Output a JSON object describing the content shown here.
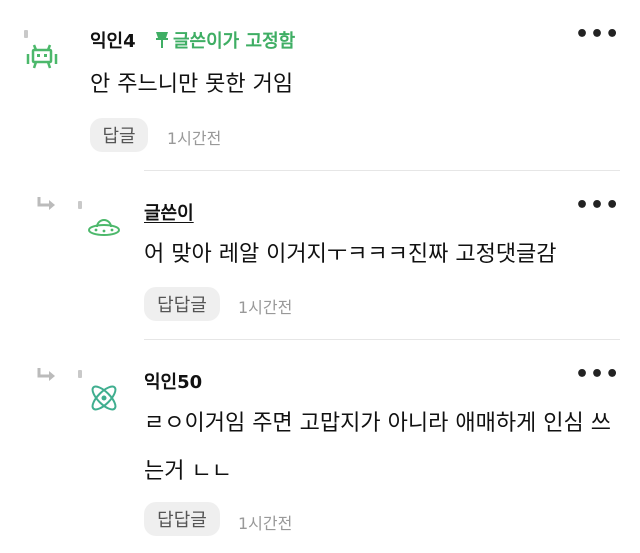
{
  "comments": [
    {
      "author": "익인4",
      "pinned_label": "글쓴이가 고정함",
      "text": "안 주느니만 못한 거임",
      "reply_label": "답글",
      "time": "1시간전",
      "more": "•••",
      "avatar_icon": "green-space-invader-icon"
    },
    {
      "author": "글쓴이",
      "text": "어 맞아 레알 이거지ㅜㅋㅋㅋ진짜 고정댓글감",
      "reply_label": "답답글",
      "time": "1시간전",
      "more": "•••",
      "avatar_icon": "ufo-icon"
    },
    {
      "author": "익인50",
      "text": "ㄹㅇ이거임 주면 고맙지가 아니라 애매하게 인심 쓰는거 ㄴㄴ",
      "reply_label": "답답글",
      "time": "1시간전",
      "more": "•••",
      "avatar_icon": "atom-icon"
    }
  ],
  "colors": {
    "pinned": "#3fae64",
    "avatar_green": "#4cb86b",
    "avatar_teal": "#3fae8f"
  }
}
